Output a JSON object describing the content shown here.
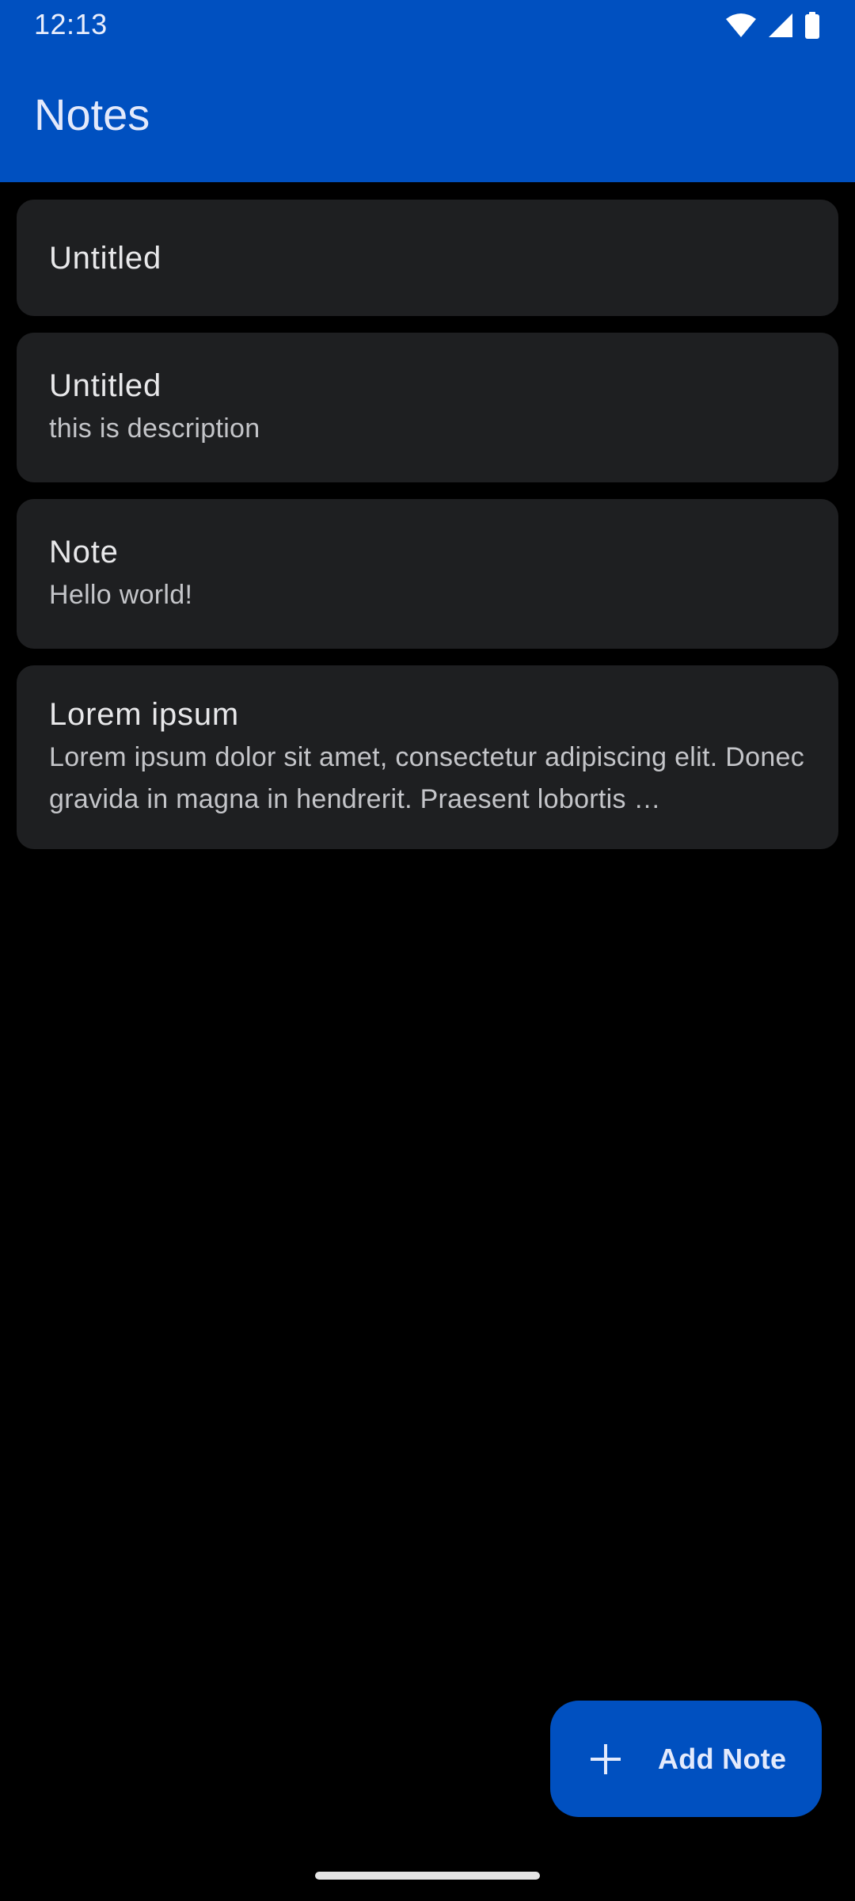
{
  "status_bar": {
    "time": "12:13",
    "icons": [
      "wifi-icon",
      "signal-icon",
      "battery-icon"
    ]
  },
  "app_bar": {
    "title": "Notes"
  },
  "notes": [
    {
      "title": "Untitled",
      "body": ""
    },
    {
      "title": "Untitled",
      "body": "this is description"
    },
    {
      "title": "Note",
      "body": "Hello world!"
    },
    {
      "title": "Lorem ipsum",
      "body": "Lorem ipsum dolor sit amet, consectetur adipiscing elit. Donec gravida in magna in hendrerit. Praesent lobortis …"
    }
  ],
  "fab": {
    "label": "Add Note",
    "icon": "plus-icon"
  },
  "colors": {
    "primary": "#0050c0",
    "background": "#000000",
    "card": "#1e1f21",
    "title_text": "#e8e8ea",
    "body_text": "#c4c5c9"
  }
}
